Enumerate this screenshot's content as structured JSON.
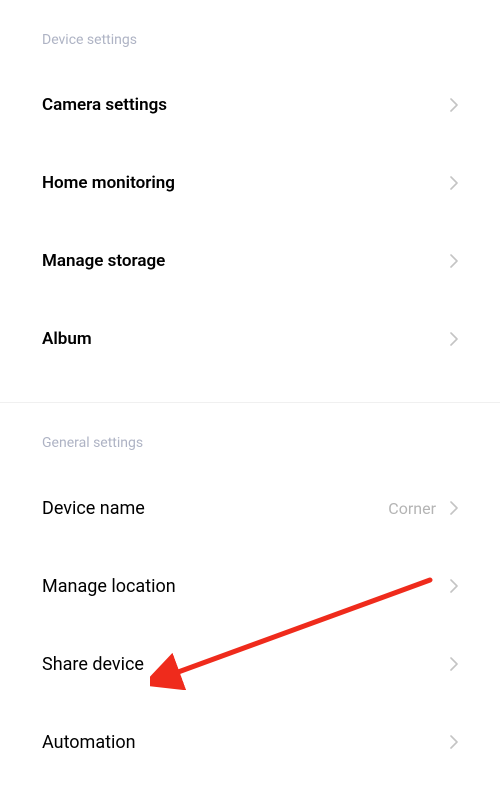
{
  "sections": {
    "device": {
      "header": "Device settings",
      "items": [
        {
          "label": "Camera settings"
        },
        {
          "label": "Home monitoring"
        },
        {
          "label": "Manage storage"
        },
        {
          "label": "Album"
        }
      ]
    },
    "general": {
      "header": "General settings",
      "items": [
        {
          "label": "Device name",
          "value": "Corner"
        },
        {
          "label": "Manage location"
        },
        {
          "label": "Share device"
        },
        {
          "label": "Automation"
        }
      ]
    }
  }
}
